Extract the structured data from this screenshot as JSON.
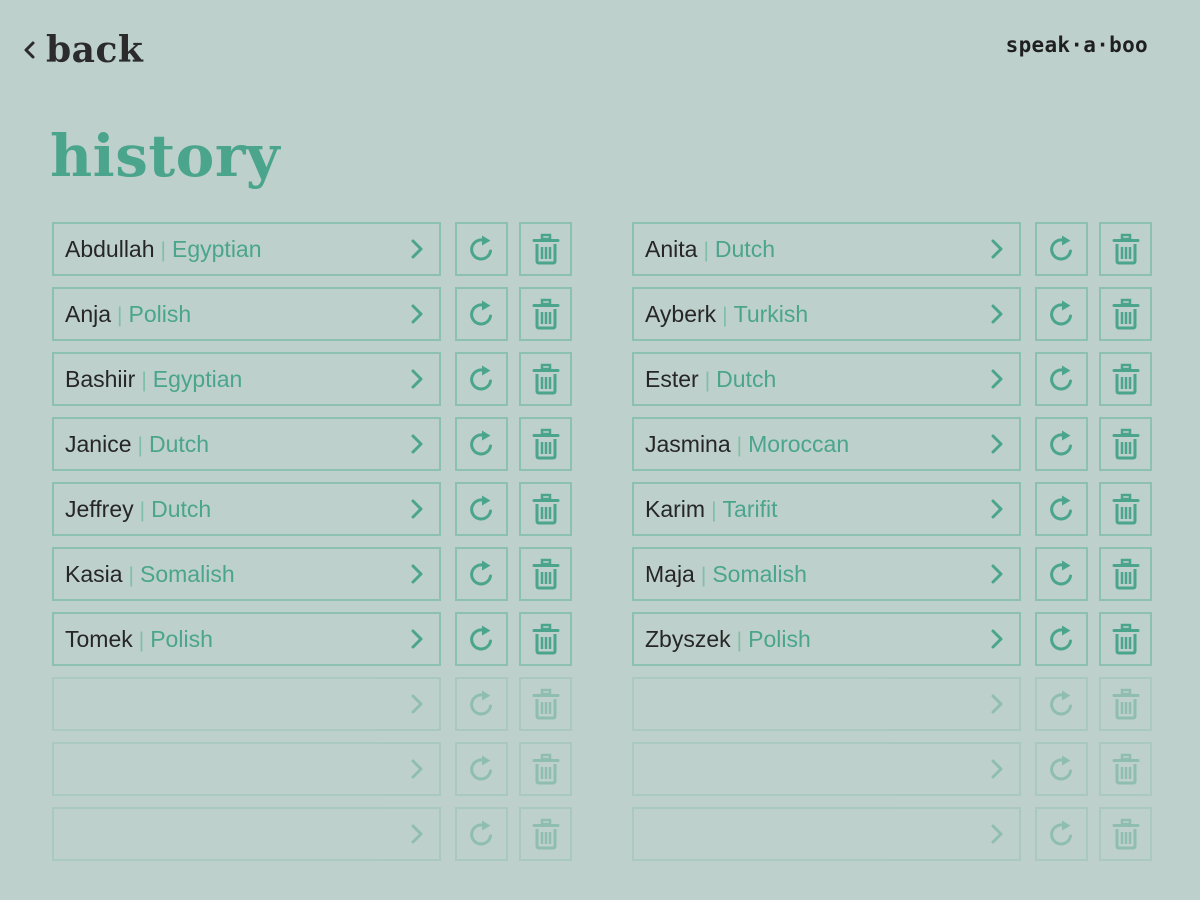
{
  "header": {
    "back_label": "back",
    "logo_text": "speak·a·boo"
  },
  "page_title": "history",
  "colors": {
    "background": "#bed0cb",
    "accent": "#4aa58c",
    "border": "#8cc1b1",
    "text_dark": "#262626"
  },
  "icons": {
    "back": "chevron-left-icon",
    "open": "chevron-right-icon",
    "replay": "replay-icon",
    "delete": "trash-icon"
  },
  "history": {
    "left": [
      {
        "name": "Abdullah",
        "separator": "|",
        "language": "Egyptian"
      },
      {
        "name": "Anja",
        "separator": "|",
        "language": "Polish"
      },
      {
        "name": "Bashiir",
        "separator": "|",
        "language": "Egyptian"
      },
      {
        "name": "Janice",
        "separator": "|",
        "language": "Dutch"
      },
      {
        "name": "Jeffrey",
        "separator": "|",
        "language": "Dutch"
      },
      {
        "name": "Kasia",
        "separator": "|",
        "language": "Somalish"
      },
      {
        "name": "Tomek",
        "separator": "|",
        "language": "Polish"
      }
    ],
    "right": [
      {
        "name": "Anita",
        "separator": "|",
        "language": "Dutch"
      },
      {
        "name": "Ayberk",
        "separator": "|",
        "language": "Turkish"
      },
      {
        "name": "Ester",
        "separator": "|",
        "language": "Dutch"
      },
      {
        "name": "Jasmina",
        "separator": "|",
        "language": "Moroccan"
      },
      {
        "name": "Karim",
        "separator": "|",
        "language": "Tarifit"
      },
      {
        "name": "Maja",
        "separator": "|",
        "language": "Somalish"
      },
      {
        "name": "Zbyszek",
        "separator": "|",
        "language": "Polish"
      }
    ]
  }
}
